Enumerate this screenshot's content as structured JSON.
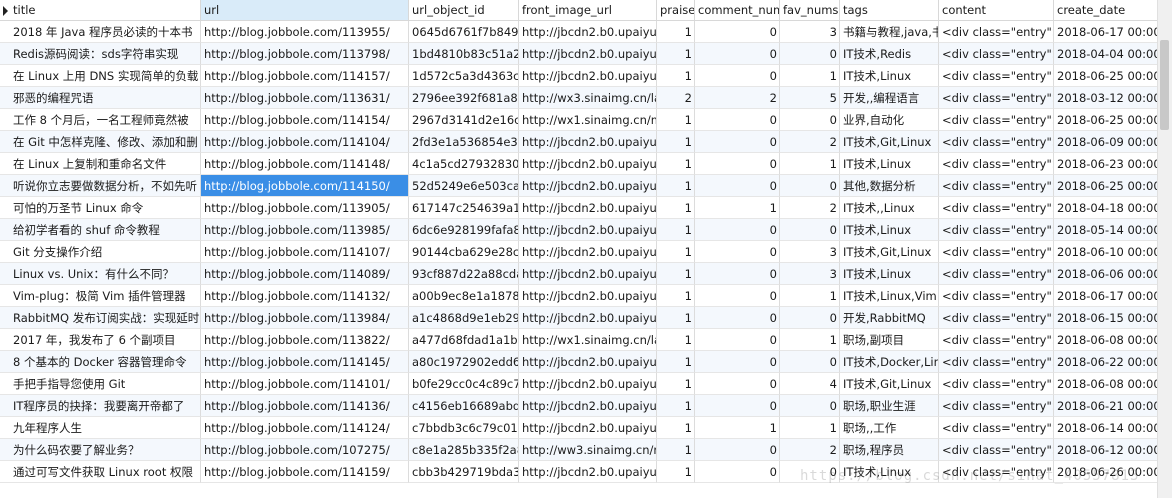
{
  "headers": [
    "title",
    "url",
    "url_object_id",
    "front_image_url",
    "praise",
    "comment_num",
    "fav_nums",
    "tags",
    "content",
    "create_date"
  ],
  "rows": [
    {
      "title": "2018 年 Java 程序员必读的十本书",
      "url": "http://blog.jobbole.com/113955/",
      "url_object_id": "0645d6761f7b8492",
      "front_image_url": "http://jbcdn2.b0.upaiyun",
      "praise": "1",
      "comment_num": "0",
      "fav_nums": "3",
      "tags": "书籍与教程,java,书",
      "content": "<div class=\"entry\">",
      "create_date": "2018-06-17 00:00:00"
    },
    {
      "title": "Redis源码阅读：sds字符串实现",
      "url": "http://blog.jobbole.com/113798/",
      "url_object_id": "1bd4810b83c51a2",
      "front_image_url": "http://jbcdn2.b0.upaiyun",
      "praise": "1",
      "comment_num": "0",
      "fav_nums": "0",
      "tags": "IT技术,Redis",
      "content": "<div class=\"entry\">",
      "create_date": "2018-04-04 00:00:00"
    },
    {
      "title": "在 Linux 上用 DNS 实现简单的负载",
      "url": "http://blog.jobbole.com/114157/",
      "url_object_id": "1d572c5a3d4363c",
      "front_image_url": "http://jbcdn2.b0.upaiyun",
      "praise": "1",
      "comment_num": "0",
      "fav_nums": "1",
      "tags": "IT技术,Linux",
      "content": "<div class=\"entry\">",
      "create_date": "2018-06-25 00:00:00"
    },
    {
      "title": "邪恶的编程咒语",
      "url": "http://blog.jobbole.com/113631/",
      "url_object_id": "2796ee392f681a8f",
      "front_image_url": "http://wx3.sinaimg.cn/la",
      "praise": "2",
      "comment_num": "2",
      "fav_nums": "5",
      "tags": "开发,,编程语言",
      "content": "<div class=\"entry\">",
      "create_date": "2018-03-12 00:00:00"
    },
    {
      "title": "工作 8 个月后，一名工程师竟然被",
      "url": "http://blog.jobbole.com/114154/",
      "url_object_id": "2967d3141d2e16c",
      "front_image_url": "http://wx1.sinaimg.cn/m",
      "praise": "1",
      "comment_num": "0",
      "fav_nums": "0",
      "tags": "业界,自动化",
      "content": "<div class=\"entry\">",
      "create_date": "2018-06-25 00:00:00"
    },
    {
      "title": "在 Git 中怎样克隆、修改、添加和删",
      "url": "http://blog.jobbole.com/114104/",
      "url_object_id": "2fd3e1a536854e33",
      "front_image_url": "http://jbcdn2.b0.upaiyun",
      "praise": "1",
      "comment_num": "0",
      "fav_nums": "2",
      "tags": "IT技术,Git,Linux",
      "content": "<div class=\"entry\">",
      "create_date": "2018-06-09 00:00:00"
    },
    {
      "title": "在 Linux 上复制和重命名文件",
      "url": "http://blog.jobbole.com/114148/",
      "url_object_id": "4c1a5cd279328300",
      "front_image_url": "http://jbcdn2.b0.upaiyun",
      "praise": "1",
      "comment_num": "0",
      "fav_nums": "1",
      "tags": "IT技术,Linux",
      "content": "<div class=\"entry\">",
      "create_date": "2018-06-23 00:00:00"
    },
    {
      "title": "听说你立志要做数据分析，不如先听",
      "url": "http://blog.jobbole.com/114150/",
      "url_object_id": "52d5249e6e503ca",
      "front_image_url": "http://jbcdn2.b0.upaiyun",
      "praise": "1",
      "comment_num": "0",
      "fav_nums": "0",
      "tags": "其他,数据分析",
      "content": "<div class=\"entry\">",
      "create_date": "2018-06-25 00:00:00"
    },
    {
      "title": "可怕的万圣节 Linux 命令",
      "url": "http://blog.jobbole.com/113905/",
      "url_object_id": "617147c254639a1",
      "front_image_url": "http://jbcdn2.b0.upaiyun",
      "praise": "1",
      "comment_num": "1",
      "fav_nums": "2",
      "tags": "IT技术,,Linux",
      "content": "<div class=\"entry\">",
      "create_date": "2018-04-18 00:00:00"
    },
    {
      "title": "给初学者看的 shuf 命令教程",
      "url": "http://blog.jobbole.com/113985/",
      "url_object_id": "6dc6e928199fafa8",
      "front_image_url": "http://jbcdn2.b0.upaiyun",
      "praise": "1",
      "comment_num": "0",
      "fav_nums": "0",
      "tags": "IT技术,Linux",
      "content": "<div class=\"entry\">",
      "create_date": "2018-05-14 00:00:00"
    },
    {
      "title": "Git 分支操作介绍",
      "url": "http://blog.jobbole.com/114107/",
      "url_object_id": "90144cba629e28c",
      "front_image_url": "http://jbcdn2.b0.upaiyun",
      "praise": "1",
      "comment_num": "0",
      "fav_nums": "3",
      "tags": "IT技术,Git,Linux",
      "content": "<div class=\"entry\">",
      "create_date": "2018-06-10 00:00:00"
    },
    {
      "title": "Linux vs. Unix：有什么不同？",
      "url": "http://blog.jobbole.com/114089/",
      "url_object_id": "93cf887d22a88cda",
      "front_image_url": "http://jbcdn2.b0.upaiyun",
      "praise": "1",
      "comment_num": "0",
      "fav_nums": "3",
      "tags": "IT技术,Linux",
      "content": "<div class=\"entry\">",
      "create_date": "2018-06-06 00:00:00"
    },
    {
      "title": "Vim-plug：极简 Vim 插件管理器",
      "url": "http://blog.jobbole.com/114132/",
      "url_object_id": "a00b9ec8e1a1878",
      "front_image_url": "http://jbcdn2.b0.upaiyun",
      "praise": "1",
      "comment_num": "0",
      "fav_nums": "1",
      "tags": "IT技术,Linux,Vim",
      "content": "<div class=\"entry\">",
      "create_date": "2018-06-17 00:00:00"
    },
    {
      "title": "RabbitMQ 发布订阅实战：实现延时",
      "url": "http://blog.jobbole.com/113984/",
      "url_object_id": "a1c4868d9e1eb29",
      "front_image_url": "http://jbcdn2.b0.upaiyun",
      "praise": "1",
      "comment_num": "0",
      "fav_nums": "0",
      "tags": "开发,RabbitMQ",
      "content": "<div class=\"entry\">",
      "create_date": "2018-06-15 00:00:00"
    },
    {
      "title": "2017 年，我发布了 6 个副项目",
      "url": "http://blog.jobbole.com/113822/",
      "url_object_id": "a477d68fdad1a1b",
      "front_image_url": "http://wx1.sinaimg.cn/la",
      "praise": "1",
      "comment_num": "0",
      "fav_nums": "1",
      "tags": "职场,副项目",
      "content": "<div class=\"entry\">",
      "create_date": "2018-06-08 00:00:00"
    },
    {
      "title": "8 个基本的 Docker 容器管理命令",
      "url": "http://blog.jobbole.com/114145/",
      "url_object_id": "a80c1972902edd6",
      "front_image_url": "http://jbcdn2.b0.upaiyun",
      "praise": "1",
      "comment_num": "0",
      "fav_nums": "0",
      "tags": "IT技术,Docker,Lin",
      "content": "<div class=\"entry\">",
      "create_date": "2018-06-22 00:00:00"
    },
    {
      "title": "手把手指导您使用 Git",
      "url": "http://blog.jobbole.com/114101/",
      "url_object_id": "b0fe29cc0c4c89c7",
      "front_image_url": "http://jbcdn2.b0.upaiyun",
      "praise": "1",
      "comment_num": "0",
      "fav_nums": "4",
      "tags": "IT技术,Git,Linux",
      "content": "<div class=\"entry\">",
      "create_date": "2018-06-08 00:00:00"
    },
    {
      "title": "IT程序员的抉择：我要离开帝都了",
      "url": "http://blog.jobbole.com/114136/",
      "url_object_id": "c4156eb16689abd",
      "front_image_url": "http://jbcdn2.b0.upaiyun",
      "praise": "1",
      "comment_num": "0",
      "fav_nums": "0",
      "tags": "职场,职业生涯",
      "content": "<div class=\"entry\">",
      "create_date": "2018-06-21 00:00:00"
    },
    {
      "title": "九年程序人生",
      "url": "http://blog.jobbole.com/114124/",
      "url_object_id": "c7bbdb3c6c79c01",
      "front_image_url": "http://jbcdn2.b0.upaiyun",
      "praise": "1",
      "comment_num": "1",
      "fav_nums": "1",
      "tags": "职场,,工作",
      "content": "<div class=\"entry\">",
      "create_date": "2018-06-14 00:00:00"
    },
    {
      "title": "为什么码农要了解业务？",
      "url": "http://blog.jobbole.com/107275/",
      "url_object_id": "c8e1a285b335f2a8",
      "front_image_url": "http://ww3.sinaimg.cn/m",
      "praise": "1",
      "comment_num": "0",
      "fav_nums": "2",
      "tags": "职场,程序员",
      "content": "<div class=\"entry\">",
      "create_date": "2018-06-12 00:00:00"
    },
    {
      "title": "通过可写文件获取 Linux root 权限",
      "url": "http://blog.jobbole.com/114159/",
      "url_object_id": "cbb3b429719bda3",
      "front_image_url": "http://jbcdn2.b0.upaiyun",
      "praise": "1",
      "comment_num": "0",
      "fav_nums": "0",
      "tags": "IT技术,Linux",
      "content": "<div class=\"entry\">",
      "create_date": "2018-06-26 00:00:00"
    }
  ],
  "selected_row_index": 7,
  "selected_column": "url",
  "watermark": "https://blog.csdn.net/sinat_40557813"
}
